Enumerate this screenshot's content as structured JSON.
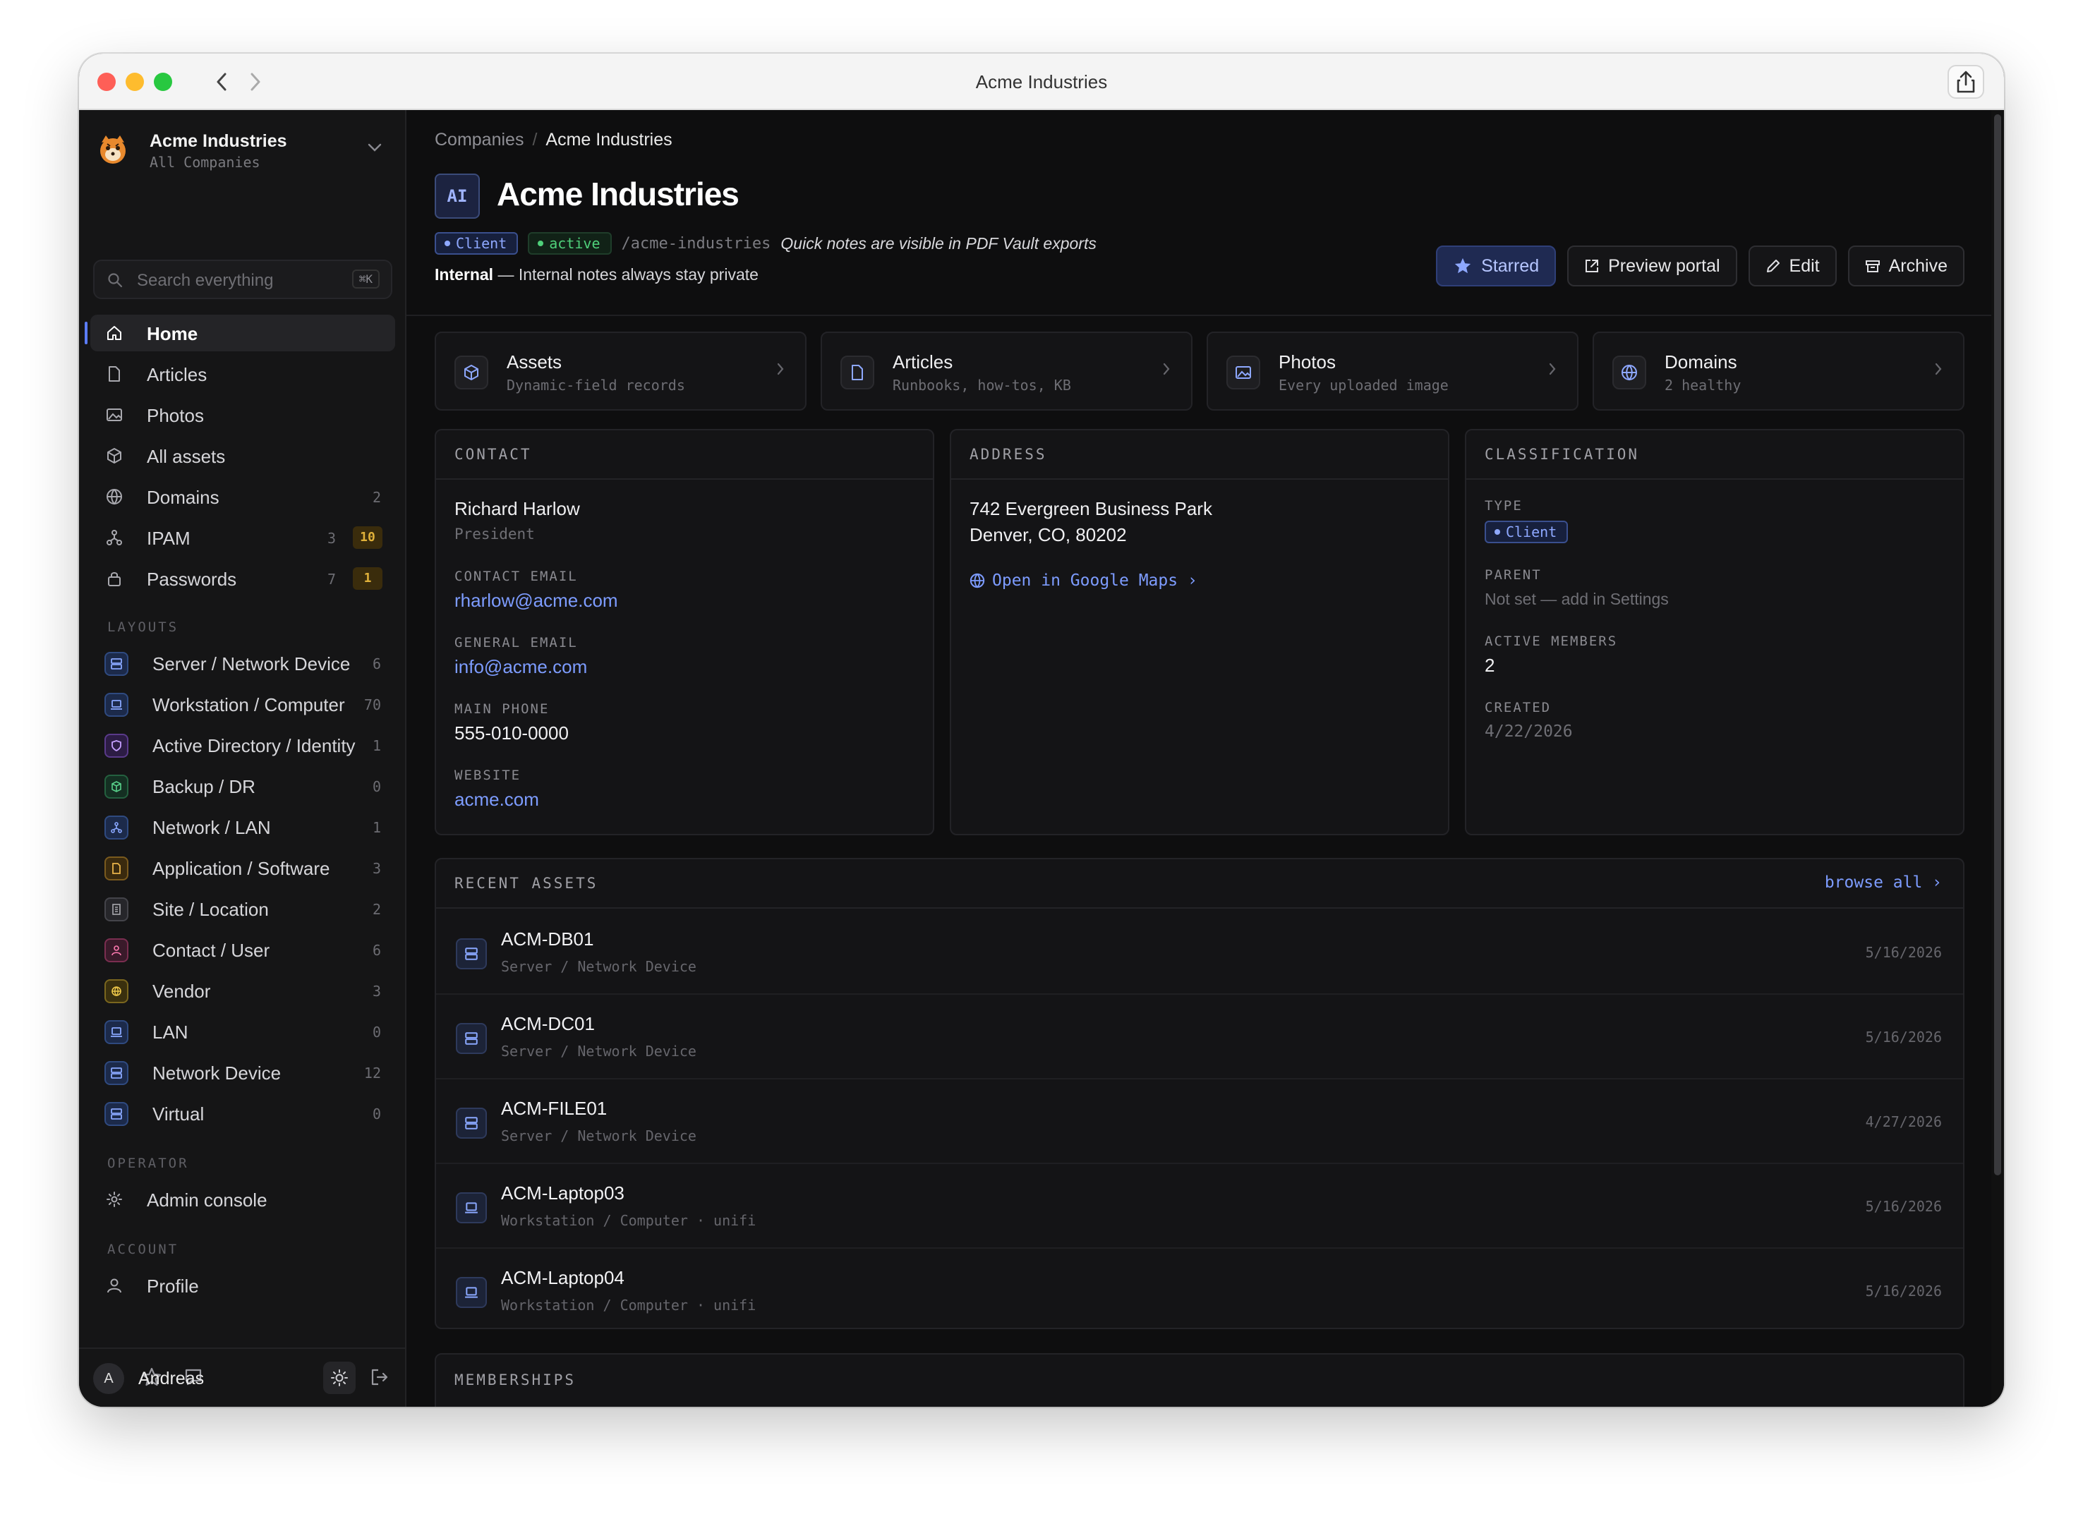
{
  "window": {
    "title": "Acme Industries"
  },
  "org": {
    "name": "Acme Industries",
    "sub": "All Companies"
  },
  "search": {
    "placeholder": "Search everything",
    "shortcut": "⌘K"
  },
  "nav": [
    {
      "label": "Home",
      "count": "",
      "badge": ""
    },
    {
      "label": "Articles",
      "count": "",
      "badge": ""
    },
    {
      "label": "Photos",
      "count": "",
      "badge": ""
    },
    {
      "label": "All assets",
      "count": "",
      "badge": ""
    },
    {
      "label": "Domains",
      "count": "2",
      "badge": ""
    },
    {
      "label": "IPAM",
      "count": "3",
      "badge": "10"
    },
    {
      "label": "Passwords",
      "count": "7",
      "badge": "1"
    }
  ],
  "sections": {
    "layouts": "LAYOUTS",
    "operator": "OPERATOR",
    "account": "ACCOUNT"
  },
  "layouts": [
    {
      "label": "Server / Network Device",
      "count": "6"
    },
    {
      "label": "Workstation / Computer",
      "count": "70"
    },
    {
      "label": "Active Directory / Identity",
      "count": "1"
    },
    {
      "label": "Backup / DR",
      "count": "0"
    },
    {
      "label": "Network / LAN",
      "count": "1"
    },
    {
      "label": "Application / Software",
      "count": "3"
    },
    {
      "label": "Site / Location",
      "count": "2"
    },
    {
      "label": "Contact / User",
      "count": "6"
    },
    {
      "label": "Vendor",
      "count": "3"
    },
    {
      "label": "LAN",
      "count": "0"
    },
    {
      "label": "Network Device",
      "count": "12"
    },
    {
      "label": "Virtual",
      "count": "0"
    }
  ],
  "operator": {
    "label": "Admin console"
  },
  "account": {
    "label": "Profile"
  },
  "user": {
    "initial": "A",
    "name": "Andreas"
  },
  "breadcrumb": {
    "parent": "Companies",
    "sep": "/",
    "current": "Acme Industries"
  },
  "page": {
    "badge": "AI",
    "title": "Acme Industries",
    "tag_client": "Client",
    "tag_active": "active",
    "slug": "/acme-industries",
    "quick_note": "Quick notes are visible in PDF Vault exports",
    "internal_label": "Internal",
    "internal_text": " — Internal notes always stay private"
  },
  "actions": {
    "starred": "Starred",
    "preview": "Preview portal",
    "edit": "Edit",
    "archive": "Archive"
  },
  "quick_cards": [
    {
      "title": "Assets",
      "sub": "Dynamic-field records"
    },
    {
      "title": "Articles",
      "sub": "Runbooks, how-tos, KB"
    },
    {
      "title": "Photos",
      "sub": "Every uploaded image"
    },
    {
      "title": "Domains",
      "sub": "2 healthy"
    }
  ],
  "contact": {
    "header": "CONTACT",
    "name": "Richard Harlow",
    "role": "President",
    "contact_email_label": "CONTACT EMAIL",
    "contact_email": "rharlow@acme.com",
    "general_email_label": "GENERAL EMAIL",
    "general_email": "info@acme.com",
    "phone_label": "MAIN PHONE",
    "phone": "555-010-0000",
    "website_label": "WEBSITE",
    "website": "acme.com"
  },
  "address": {
    "header": "ADDRESS",
    "line1": "742 Evergreen Business Park",
    "line2": "Denver, CO, 80202",
    "maps_link": "Open in Google Maps ›"
  },
  "classification": {
    "header": "CLASSIFICATION",
    "type_label": "TYPE",
    "type": "Client",
    "parent_label": "PARENT",
    "parent": "Not set — add in Settings",
    "members_label": "ACTIVE MEMBERS",
    "members": "2",
    "created_label": "CREATED",
    "created": "4/22/2026"
  },
  "recent": {
    "header": "RECENT ASSETS",
    "browse": "browse all ›",
    "rows": [
      {
        "name": "ACM-DB01",
        "sub": "Server / Network Device",
        "date": "5/16/2026"
      },
      {
        "name": "ACM-DC01",
        "sub": "Server / Network Device",
        "date": "5/16/2026"
      },
      {
        "name": "ACM-FILE01",
        "sub": "Server / Network Device",
        "date": "4/27/2026"
      },
      {
        "name": "ACM-Laptop03",
        "sub": "Workstation / Computer · unifi",
        "date": "5/16/2026"
      },
      {
        "name": "ACM-Laptop04",
        "sub": "Workstation / Computer · unifi",
        "date": "5/16/2026"
      }
    ]
  },
  "memberships": {
    "header": "MEMBERSHIPS"
  },
  "colors": {
    "accent": "#7d9cff",
    "active_green": "#4fd07a",
    "warn": "#e0b13a",
    "bg": "#0e0e0f",
    "sidebar": "#151516"
  }
}
